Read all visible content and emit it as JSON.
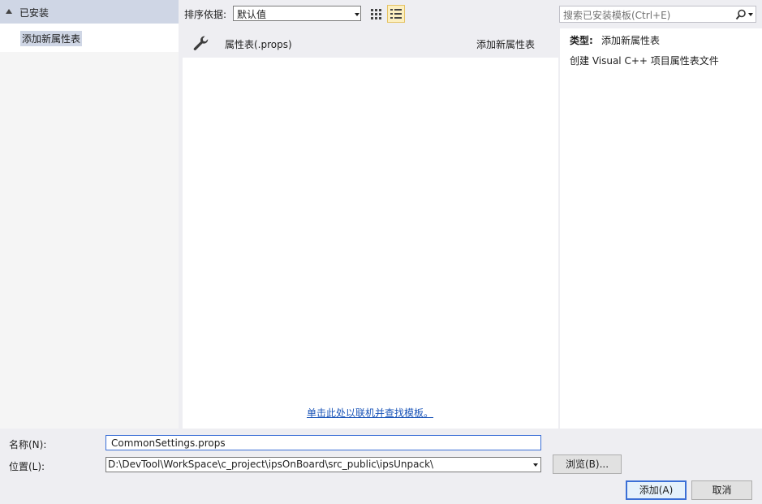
{
  "tree": {
    "header_label": "已安装",
    "selected_item": "添加新属性表"
  },
  "toolbar": {
    "sort_label": "排序依据:",
    "sort_value": "默认值",
    "search_placeholder": "搜索已安装模板(Ctrl+E)"
  },
  "templates": [
    {
      "name": "属性表(.props)",
      "type": "添加新属性表",
      "icon": "wrench-icon"
    }
  ],
  "online_link": "单击此处以联机并查找模板。",
  "details": {
    "type_label": "类型:",
    "type_value": "添加新属性表",
    "description": "创建 Visual C++ 项目属性表文件"
  },
  "form": {
    "name_label": "名称(N):",
    "name_value": "CommonSettings.props",
    "location_label": "位置(L):",
    "location_value": "D:\\DevTool\\WorkSpace\\c_project\\ipsOnBoard\\src_public\\ipsUnpack\\",
    "browse_label": "浏览(B)...",
    "add_label": "添加(A)",
    "cancel_label": "取消"
  }
}
